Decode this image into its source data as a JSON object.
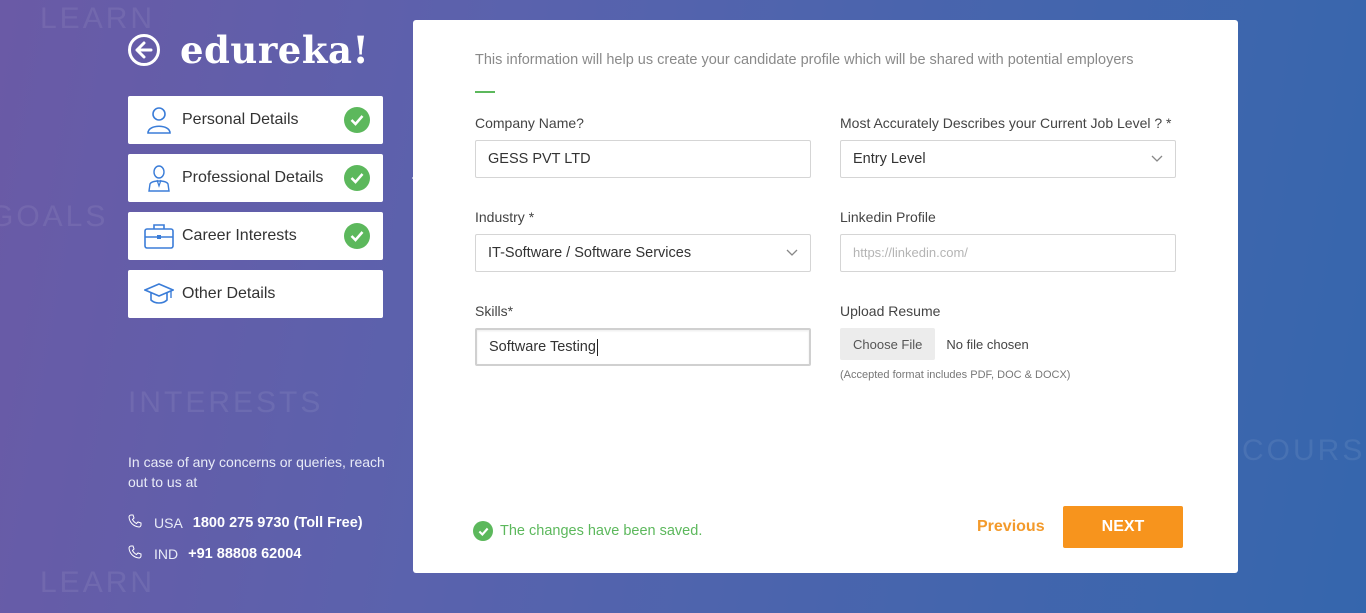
{
  "background": {
    "words": [
      "LEARN",
      "GOALS",
      "INTERESTS",
      "COURSES",
      "LEARN"
    ]
  },
  "brand": {
    "name": "edureka!",
    "back_icon": "arrow-left-circle-icon"
  },
  "steps": [
    {
      "label": "Personal Details",
      "icon": "user-icon",
      "completed": true
    },
    {
      "label": "Professional Details",
      "icon": "professional-icon",
      "completed": true,
      "active": true
    },
    {
      "label": "Career Interests",
      "icon": "briefcase-icon",
      "completed": true
    },
    {
      "label": "Other Details",
      "icon": "graduation-cap-icon",
      "completed": false
    }
  ],
  "contact": {
    "message": "In case of any concerns or queries, reach out to us at",
    "phones": [
      {
        "country": "USA",
        "number": "1800 275 9730 (Toll Free)"
      },
      {
        "country": "IND",
        "number": "+91 88808 62004"
      }
    ]
  },
  "form": {
    "intro": "This information will help us create your candidate profile which will be shared with potential employers",
    "company": {
      "label": "Company Name?",
      "value": "GESS PVT LTD"
    },
    "job_level": {
      "label": "Most Accurately Describes your Current Job Level ? *",
      "value": "Entry Level"
    },
    "industry": {
      "label": "Industry *",
      "value": "IT-Software / Software Services"
    },
    "linkedin": {
      "label": "Linkedin Profile",
      "value": "",
      "placeholder": "https://linkedin.com/"
    },
    "skills": {
      "label": "Skills*",
      "value": "Software Testing"
    },
    "resume": {
      "label": "Upload Resume",
      "button": "Choose File",
      "status": "No file chosen",
      "note": "(Accepted format includes PDF, DOC & DOCX)"
    }
  },
  "footer": {
    "saved_message": "The changes have been saved.",
    "previous_label": "Previous",
    "next_label": "NEXT"
  },
  "colors": {
    "accent_orange": "#f7941d",
    "success_green": "#5cb85c",
    "bg_left": "#6a5aa6",
    "bg_right": "#3566ad"
  }
}
